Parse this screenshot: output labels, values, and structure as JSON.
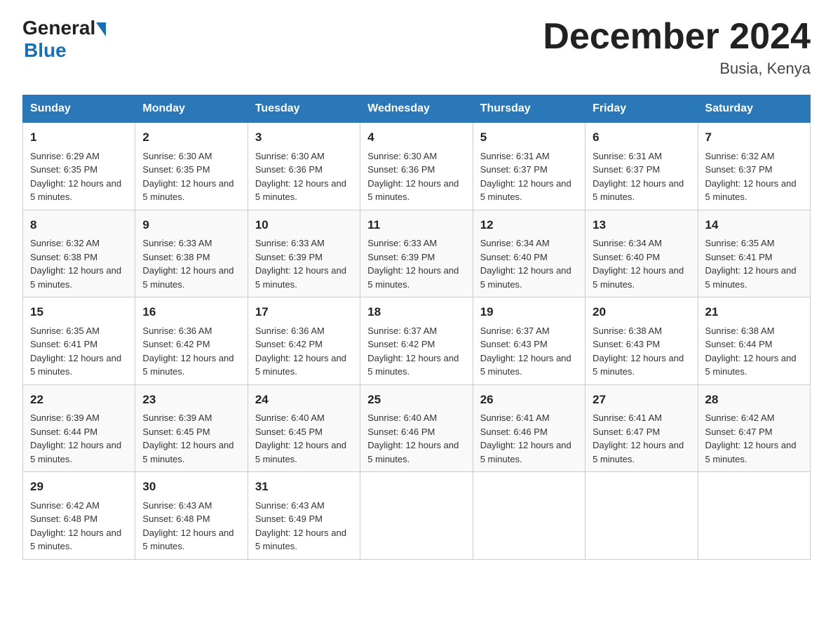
{
  "header": {
    "logo_general": "General",
    "logo_blue": "Blue",
    "month_title": "December 2024",
    "location": "Busia, Kenya"
  },
  "days_of_week": [
    "Sunday",
    "Monday",
    "Tuesday",
    "Wednesday",
    "Thursday",
    "Friday",
    "Saturday"
  ],
  "weeks": [
    [
      {
        "num": "1",
        "sunrise": "6:29 AM",
        "sunset": "6:35 PM",
        "daylight": "12 hours and 5 minutes."
      },
      {
        "num": "2",
        "sunrise": "6:30 AM",
        "sunset": "6:35 PM",
        "daylight": "12 hours and 5 minutes."
      },
      {
        "num": "3",
        "sunrise": "6:30 AM",
        "sunset": "6:36 PM",
        "daylight": "12 hours and 5 minutes."
      },
      {
        "num": "4",
        "sunrise": "6:30 AM",
        "sunset": "6:36 PM",
        "daylight": "12 hours and 5 minutes."
      },
      {
        "num": "5",
        "sunrise": "6:31 AM",
        "sunset": "6:37 PM",
        "daylight": "12 hours and 5 minutes."
      },
      {
        "num": "6",
        "sunrise": "6:31 AM",
        "sunset": "6:37 PM",
        "daylight": "12 hours and 5 minutes."
      },
      {
        "num": "7",
        "sunrise": "6:32 AM",
        "sunset": "6:37 PM",
        "daylight": "12 hours and 5 minutes."
      }
    ],
    [
      {
        "num": "8",
        "sunrise": "6:32 AM",
        "sunset": "6:38 PM",
        "daylight": "12 hours and 5 minutes."
      },
      {
        "num": "9",
        "sunrise": "6:33 AM",
        "sunset": "6:38 PM",
        "daylight": "12 hours and 5 minutes."
      },
      {
        "num": "10",
        "sunrise": "6:33 AM",
        "sunset": "6:39 PM",
        "daylight": "12 hours and 5 minutes."
      },
      {
        "num": "11",
        "sunrise": "6:33 AM",
        "sunset": "6:39 PM",
        "daylight": "12 hours and 5 minutes."
      },
      {
        "num": "12",
        "sunrise": "6:34 AM",
        "sunset": "6:40 PM",
        "daylight": "12 hours and 5 minutes."
      },
      {
        "num": "13",
        "sunrise": "6:34 AM",
        "sunset": "6:40 PM",
        "daylight": "12 hours and 5 minutes."
      },
      {
        "num": "14",
        "sunrise": "6:35 AM",
        "sunset": "6:41 PM",
        "daylight": "12 hours and 5 minutes."
      }
    ],
    [
      {
        "num": "15",
        "sunrise": "6:35 AM",
        "sunset": "6:41 PM",
        "daylight": "12 hours and 5 minutes."
      },
      {
        "num": "16",
        "sunrise": "6:36 AM",
        "sunset": "6:42 PM",
        "daylight": "12 hours and 5 minutes."
      },
      {
        "num": "17",
        "sunrise": "6:36 AM",
        "sunset": "6:42 PM",
        "daylight": "12 hours and 5 minutes."
      },
      {
        "num": "18",
        "sunrise": "6:37 AM",
        "sunset": "6:42 PM",
        "daylight": "12 hours and 5 minutes."
      },
      {
        "num": "19",
        "sunrise": "6:37 AM",
        "sunset": "6:43 PM",
        "daylight": "12 hours and 5 minutes."
      },
      {
        "num": "20",
        "sunrise": "6:38 AM",
        "sunset": "6:43 PM",
        "daylight": "12 hours and 5 minutes."
      },
      {
        "num": "21",
        "sunrise": "6:38 AM",
        "sunset": "6:44 PM",
        "daylight": "12 hours and 5 minutes."
      }
    ],
    [
      {
        "num": "22",
        "sunrise": "6:39 AM",
        "sunset": "6:44 PM",
        "daylight": "12 hours and 5 minutes."
      },
      {
        "num": "23",
        "sunrise": "6:39 AM",
        "sunset": "6:45 PM",
        "daylight": "12 hours and 5 minutes."
      },
      {
        "num": "24",
        "sunrise": "6:40 AM",
        "sunset": "6:45 PM",
        "daylight": "12 hours and 5 minutes."
      },
      {
        "num": "25",
        "sunrise": "6:40 AM",
        "sunset": "6:46 PM",
        "daylight": "12 hours and 5 minutes."
      },
      {
        "num": "26",
        "sunrise": "6:41 AM",
        "sunset": "6:46 PM",
        "daylight": "12 hours and 5 minutes."
      },
      {
        "num": "27",
        "sunrise": "6:41 AM",
        "sunset": "6:47 PM",
        "daylight": "12 hours and 5 minutes."
      },
      {
        "num": "28",
        "sunrise": "6:42 AM",
        "sunset": "6:47 PM",
        "daylight": "12 hours and 5 minutes."
      }
    ],
    [
      {
        "num": "29",
        "sunrise": "6:42 AM",
        "sunset": "6:48 PM",
        "daylight": "12 hours and 5 minutes."
      },
      {
        "num": "30",
        "sunrise": "6:43 AM",
        "sunset": "6:48 PM",
        "daylight": "12 hours and 5 minutes."
      },
      {
        "num": "31",
        "sunrise": "6:43 AM",
        "sunset": "6:49 PM",
        "daylight": "12 hours and 5 minutes."
      },
      null,
      null,
      null,
      null
    ]
  ]
}
